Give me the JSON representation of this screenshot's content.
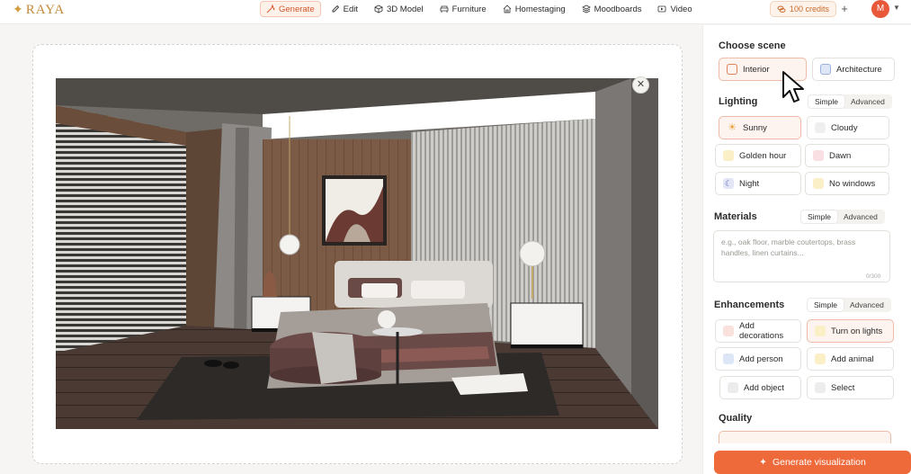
{
  "brand": {
    "name": "RAYA"
  },
  "nav": {
    "items": [
      {
        "label": "Generate",
        "icon": "sparkle-pen-icon",
        "active": true
      },
      {
        "label": "Edit",
        "icon": "pencil-icon",
        "active": false
      },
      {
        "label": "3D Model",
        "icon": "cube-icon",
        "active": false
      },
      {
        "label": "Furniture",
        "icon": "armchair-icon",
        "active": false
      },
      {
        "label": "Homestaging",
        "icon": "home-icon",
        "active": false
      },
      {
        "label": "Moodboards",
        "icon": "layers-icon",
        "active": false
      },
      {
        "label": "Video",
        "icon": "video-icon",
        "active": false
      }
    ]
  },
  "account": {
    "credits": "100 credits",
    "avatar_initial": "M"
  },
  "panel": {
    "scene": {
      "title": "Choose scene",
      "options": [
        {
          "label": "Interior",
          "selected": true
        },
        {
          "label": "Architecture",
          "selected": false
        }
      ]
    },
    "lighting": {
      "title": "Lighting",
      "toggle": [
        "Simple",
        "Advanced"
      ],
      "options": [
        {
          "label": "Sunny",
          "selected": true
        },
        {
          "label": "Cloudy",
          "selected": false
        },
        {
          "label": "Golden hour",
          "selected": false
        },
        {
          "label": "Dawn",
          "selected": false
        },
        {
          "label": "Night",
          "selected": false
        },
        {
          "label": "No windows",
          "selected": false
        }
      ]
    },
    "materials": {
      "title": "Materials",
      "toggle": [
        "Simple",
        "Advanced"
      ],
      "placeholder": "e.g., oak floor, marble coutertops, brass handles, linen curtains...",
      "counter": "0/300"
    },
    "enhancements": {
      "title": "Enhancements",
      "toggle": [
        "Simple",
        "Advanced"
      ],
      "options": [
        {
          "label": "Add decorations",
          "selected": false
        },
        {
          "label": "Turn on lights",
          "selected": true
        },
        {
          "label": "Add person",
          "selected": false
        },
        {
          "label": "Add animal",
          "selected": false
        },
        {
          "label": "Add object",
          "selected": false
        },
        {
          "label": "Select",
          "selected": false
        }
      ]
    },
    "quality": {
      "title": "Quality"
    },
    "generate_label": "Generate visualization"
  },
  "colors": {
    "accent": "#ee6a3a",
    "accent_soft": "#fdf3ef",
    "brand_gold": "#c48a3c"
  }
}
